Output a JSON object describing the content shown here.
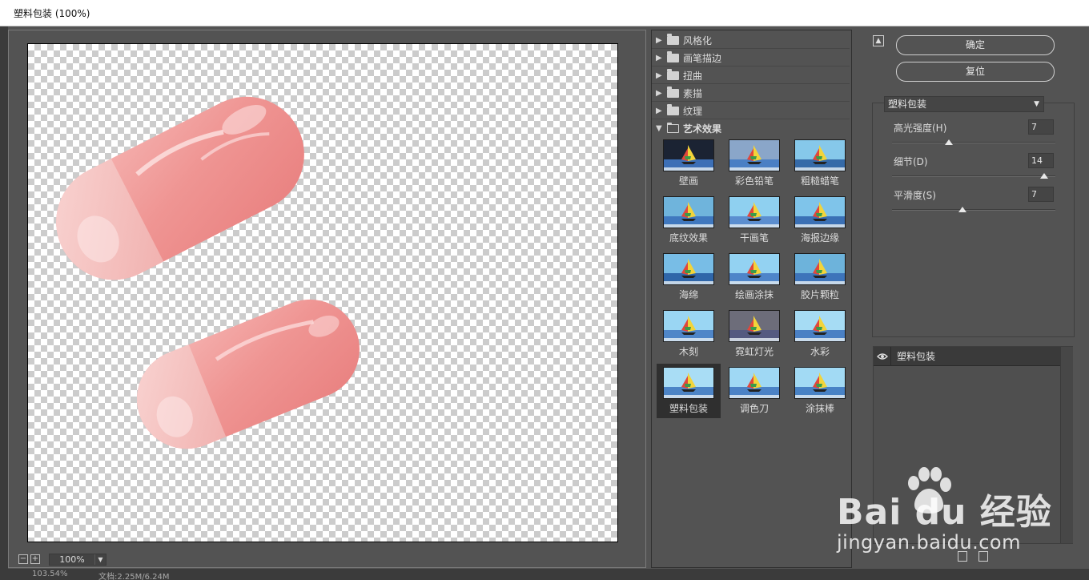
{
  "window": {
    "title": "塑料包装 (100%)"
  },
  "preview": {
    "zoom_out_label": "−",
    "zoom_in_label": "+",
    "zoom_value": "100%",
    "zoom_dropdown": "⌄"
  },
  "gallery": {
    "categories": [
      {
        "label": "风格化",
        "expanded": false
      },
      {
        "label": "画笔描边",
        "expanded": false
      },
      {
        "label": "扭曲",
        "expanded": false
      },
      {
        "label": "素描",
        "expanded": false
      },
      {
        "label": "纹理",
        "expanded": false
      },
      {
        "label": "艺术效果",
        "expanded": true
      }
    ],
    "filters": [
      {
        "label": "壁画",
        "icon": "mural-thumbnail"
      },
      {
        "label": "彩色铅笔",
        "icon": "colored-pencil-thumbnail"
      },
      {
        "label": "粗糙蜡笔",
        "icon": "rough-pastels-thumbnail"
      },
      {
        "label": "底纹效果",
        "icon": "underpainting-thumbnail"
      },
      {
        "label": "干画笔",
        "icon": "dry-brush-thumbnail"
      },
      {
        "label": "海报边缘",
        "icon": "poster-edges-thumbnail"
      },
      {
        "label": "海绵",
        "icon": "sponge-thumbnail"
      },
      {
        "label": "绘画涂抹",
        "icon": "paint-daubs-thumbnail"
      },
      {
        "label": "胶片颗粒",
        "icon": "film-grain-thumbnail"
      },
      {
        "label": "木刻",
        "icon": "cutout-thumbnail"
      },
      {
        "label": "霓虹灯光",
        "icon": "neon-glow-thumbnail"
      },
      {
        "label": "水彩",
        "icon": "watercolor-thumbnail"
      },
      {
        "label": "塑料包装",
        "icon": "plastic-wrap-thumbnail",
        "selected": true
      },
      {
        "label": "调色刀",
        "icon": "palette-knife-thumbnail"
      },
      {
        "label": "涂抹棒",
        "icon": "smudge-stick-thumbnail"
      }
    ]
  },
  "actions": {
    "ok_label": "确定",
    "reset_label": "复位"
  },
  "settings": {
    "filter_name": "塑料包装",
    "params": [
      {
        "label": "高光强度(H)",
        "value": "7",
        "fraction": 0.35
      },
      {
        "label": "细节(D)",
        "value": "14",
        "fraction": 0.93
      },
      {
        "label": "平滑度(S)",
        "value": "7",
        "fraction": 0.43
      }
    ]
  },
  "layers": {
    "effect_layer_label": "塑料包装"
  },
  "status": {
    "zoom_text": "103.54%",
    "doc_text": "文档:2.25M/6.24M"
  },
  "watermark": {
    "brand": "Bai du 经验",
    "url": "jingyan.baidu.com"
  },
  "colors": {
    "panel_bg": "#535353",
    "pill_color": "#f3a7a5",
    "selected_thumb_bg": "#2f2f2f"
  }
}
